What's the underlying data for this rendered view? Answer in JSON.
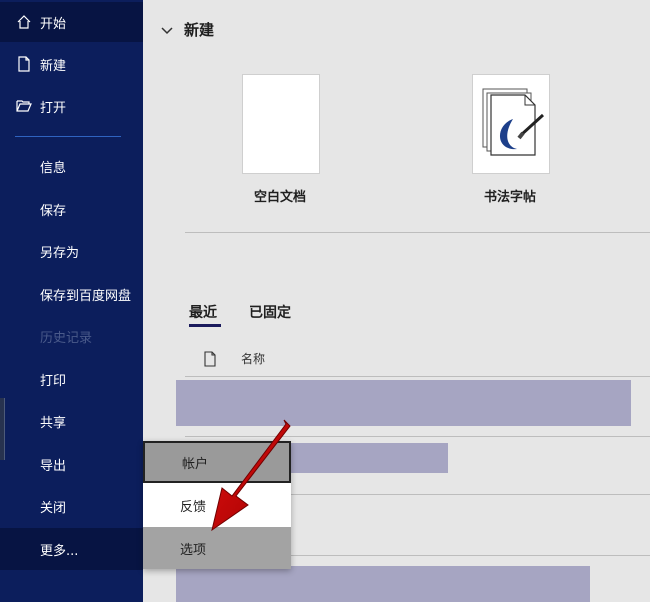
{
  "sidebar": {
    "items": [
      {
        "label": "开始",
        "icon": "home-icon"
      },
      {
        "label": "新建",
        "icon": "new-doc-icon"
      },
      {
        "label": "打开",
        "icon": "folder-open-icon"
      },
      {
        "label": "信息"
      },
      {
        "label": "保存"
      },
      {
        "label": "另存为"
      },
      {
        "label": "保存到百度网盘"
      },
      {
        "label": "历史记录"
      },
      {
        "label": "打印"
      },
      {
        "label": "共享"
      },
      {
        "label": "导出"
      },
      {
        "label": "关闭"
      },
      {
        "label": "更多..."
      }
    ]
  },
  "main": {
    "new_section_title": "新建",
    "templates": [
      {
        "label": "空白文档"
      },
      {
        "label": "书法字帖"
      }
    ],
    "tabs": [
      {
        "label": "最近"
      },
      {
        "label": "已固定"
      }
    ],
    "column_name": "名称"
  },
  "context_menu": {
    "items": [
      {
        "label": "帐户"
      },
      {
        "label": "反馈"
      },
      {
        "label": "选项"
      }
    ]
  },
  "colors": {
    "sidebar_bg": "#0c1e5c",
    "main_bg": "#e6e6e6",
    "redaction": "#a6a5c2",
    "arrow": "#d00000"
  }
}
